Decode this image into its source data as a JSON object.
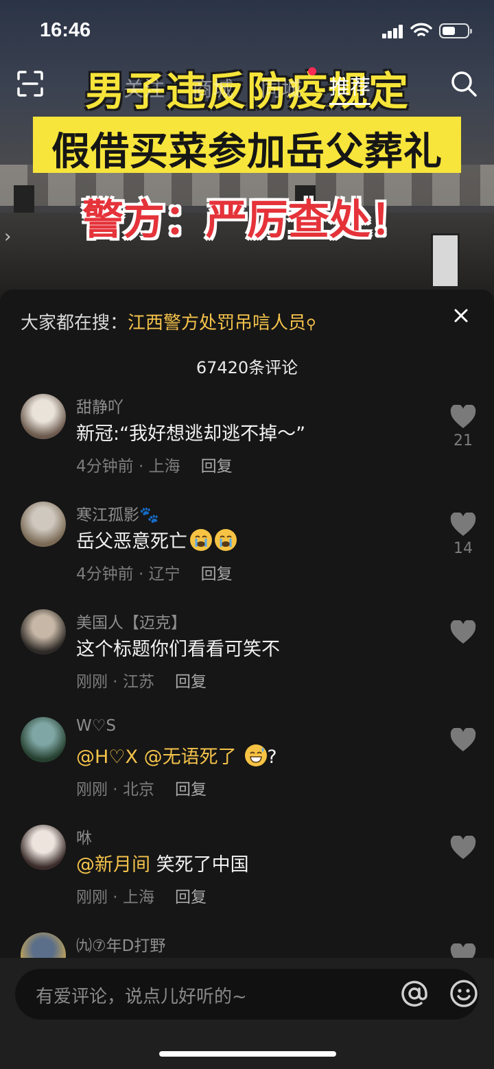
{
  "status_bar": {
    "time": "16:46",
    "battery_level": 0.5
  },
  "top_nav": {
    "tabs": [
      "关注",
      "商城",
      "同城",
      "推荐"
    ],
    "active_tab_index": 3
  },
  "video": {
    "headline_1": "男子违反防疫规定",
    "headline_2": "假借买菜参加岳父葬礼",
    "headline_3": "警方：严厉查处！"
  },
  "comments_panel": {
    "hot_search_prefix": "大家都在搜：",
    "hot_search_keyword": "江西警方处罚吊唁人员",
    "count_label": "67420条评论",
    "reply_label": "回复",
    "comments": [
      {
        "user": "甜静吖",
        "text": "新冠:“我好想逃却逃不掉～”",
        "time": "4分钟前",
        "location": "上海",
        "likes": "21",
        "avatar_colors": [
          "#e9e3da",
          "#6c5a4e"
        ]
      },
      {
        "user": "寒江孤影🐾",
        "text": "岳父恶意死亡",
        "emoji": [
          "crying-face",
          "crying-face"
        ],
        "time": "4分钟前",
        "location": "辽宁",
        "likes": "14",
        "avatar_colors": [
          "#cfc8bf",
          "#7a6a55"
        ]
      },
      {
        "user": "美国人【迈克】",
        "text": "这个标题你们看看可笑不",
        "time": "刚刚",
        "location": "江苏",
        "likes": "",
        "avatar_colors": [
          "#c7b7a6",
          "#2e2a27"
        ]
      },
      {
        "user": "W♡S",
        "mentions": [
          "@H♡X",
          "@无语死了"
        ],
        "text": "?",
        "emoji": [
          "grinning-sweat-face"
        ],
        "time": "刚刚",
        "location": "北京",
        "likes": "",
        "avatar_colors": [
          "#7fa6a4",
          "#26402f"
        ]
      },
      {
        "user": "咻",
        "mentions": [
          "@新月间"
        ],
        "text": "笑死了中国",
        "time": "刚刚",
        "location": "上海",
        "likes": "",
        "avatar_colors": [
          "#ede4de",
          "#3a2c2a"
        ]
      },
      {
        "user": "㈨⑦年D打野",
        "text": "",
        "time": "",
        "location": "",
        "likes": "",
        "avatar_colors": [
          "#5c6f8a",
          "#c7a653"
        ]
      }
    ]
  },
  "input_bar": {
    "placeholder": "有爱评论，说点儿好听的~"
  },
  "colors": {
    "accent_yellow": "#f5c34b",
    "tab_dot": "#fe2c55",
    "sheet_bg": "#161616"
  }
}
